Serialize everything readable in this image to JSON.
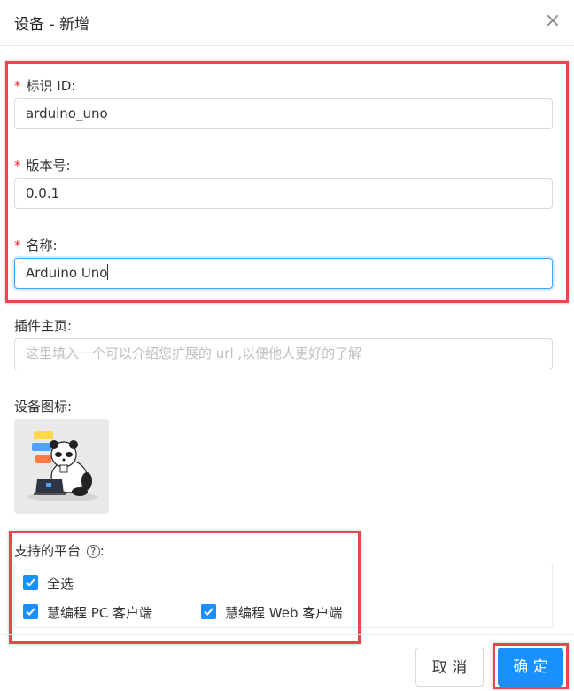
{
  "dialog": {
    "title": "设备 - 新增",
    "close_symbol": "×"
  },
  "form": {
    "id_field": {
      "required": "*",
      "label": "标识 ID:",
      "value": "arduino_uno"
    },
    "version_field": {
      "required": "*",
      "label": "版本号:",
      "value": "0.0.1"
    },
    "name_field": {
      "required": "*",
      "label": "名称:",
      "value": "Arduino Uno"
    },
    "homepage_field": {
      "label": "插件主页:",
      "placeholder": "这里填入一个可以介绍您扩展的 url ,以便他人更好的了解"
    },
    "icon_field": {
      "label": "设备图标:",
      "icon": "panda-laptop-image"
    },
    "platform_field": {
      "label": "支持的平台",
      "help_symbol": "?",
      "suffix": ":",
      "select_all": {
        "label": "全选",
        "checked": true
      },
      "options": [
        {
          "label": "慧编程 PC 客户端",
          "checked": true
        },
        {
          "label": "慧编程 Web 客户端",
          "checked": true
        }
      ]
    }
  },
  "footer": {
    "cancel_label": "取 消",
    "ok_label": "确 定"
  },
  "colors": {
    "primary": "#1890ff",
    "highlight": "#e5484d",
    "required": "#f5222d"
  }
}
